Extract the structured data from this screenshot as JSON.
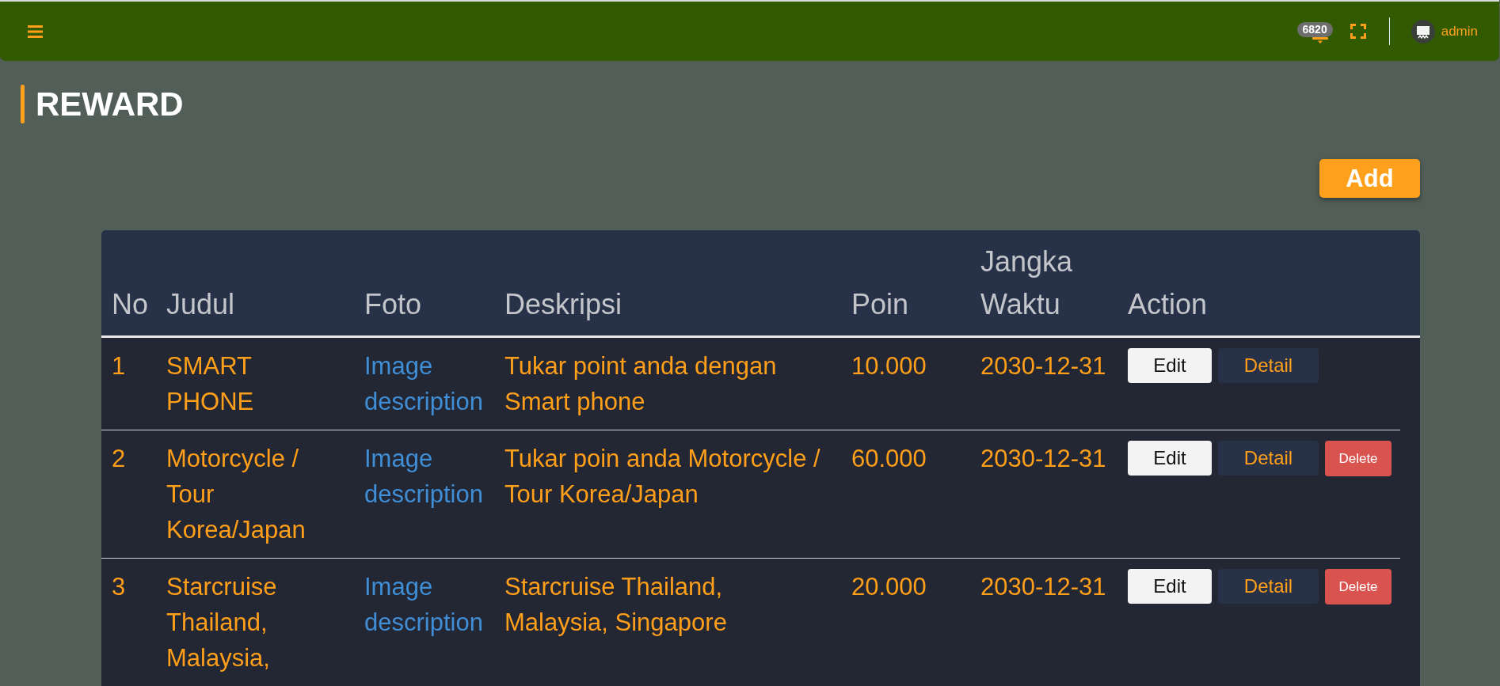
{
  "top_bar": {
    "notification_count": "6820",
    "user": "admin"
  },
  "page_title": "REWARD",
  "add_button": "Add",
  "table": {
    "columns": [
      "No",
      "Judul",
      "Foto",
      "Deskripsi",
      "Poin",
      "Jangka Waktu",
      "Action"
    ],
    "rows": [
      {
        "no": "1",
        "judul": "SMART PHONE",
        "foto": "Image description",
        "deskripsi": "Tukar point anda dengan Smart phone",
        "poin": "10.000",
        "jangka_waktu": "2030-12-31",
        "actions": [
          {
            "kind": "edit",
            "label": "Edit"
          },
          {
            "kind": "detail",
            "label": "Detail"
          }
        ]
      },
      {
        "no": "2",
        "judul": "Motorcycle / Tour Korea/Japan",
        "foto": "Image description",
        "deskripsi": "Tukar poin anda Motorcycle / Tour Korea/Japan",
        "poin": "60.000",
        "jangka_waktu": "2030-12-31",
        "actions": [
          {
            "kind": "edit",
            "label": "Edit"
          },
          {
            "kind": "detail",
            "label": "Detail"
          },
          {
            "kind": "delete",
            "label": "Delete"
          }
        ]
      },
      {
        "no": "3",
        "judul": "Starcruise Thailand, Malaysia,",
        "foto": "Image description",
        "deskripsi": "Starcruise Thailand, Malaysia, Singapore",
        "poin": "20.000",
        "jangka_waktu": "2030-12-31",
        "actions": [
          {
            "kind": "edit",
            "label": "Edit"
          },
          {
            "kind": "detail",
            "label": "Detail"
          },
          {
            "kind": "delete",
            "label": "Delete"
          }
        ]
      }
    ]
  }
}
